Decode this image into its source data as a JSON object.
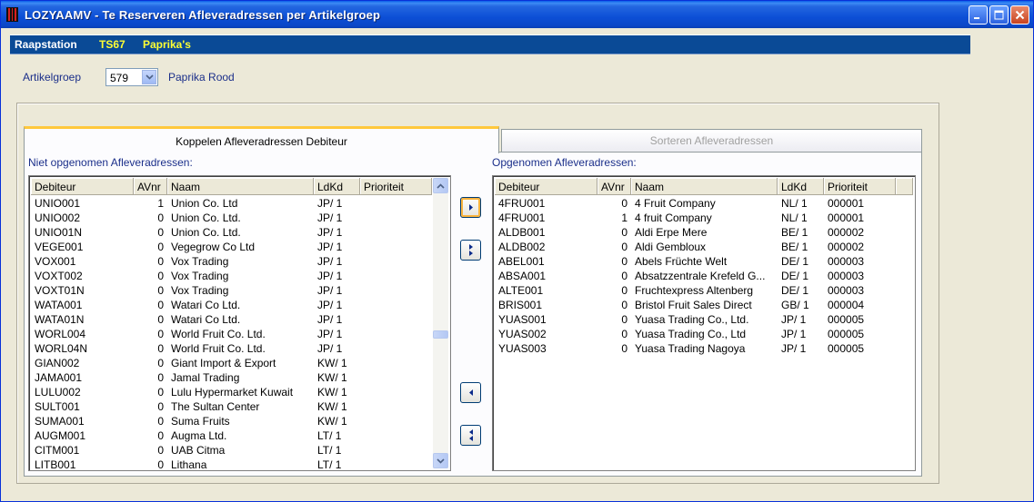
{
  "window": {
    "title": "LOZYAAMV - Te Reserveren Afleveradressen per Artikelgroep",
    "minimize": "_",
    "maximize": "□",
    "close": "✕"
  },
  "station": {
    "label": "Raapstation",
    "code": "TS67",
    "name": "Paprika's"
  },
  "artikelgroep": {
    "label": "Artikelgroep",
    "value": "579",
    "description": "Paprika Rood"
  },
  "tabs": [
    {
      "label": "Koppelen Afleveradressen Debiteur",
      "active": true
    },
    {
      "label": "Sorteren Afleveradressen",
      "active": false
    }
  ],
  "left_list": {
    "label": "Niet opgenomen Afleveradressen:",
    "columns": [
      "Debiteur",
      "AVnr",
      "Naam",
      "LdKd",
      "Prioriteit"
    ],
    "rows": [
      [
        "UNIO001",
        "1",
        "Union Co. Ltd",
        "JP/ 1",
        ""
      ],
      [
        "UNIO002",
        "0",
        "Union Co. Ltd.",
        "JP/ 1",
        ""
      ],
      [
        "UNIO01N",
        "0",
        "Union Co. Ltd.",
        "JP/ 1",
        ""
      ],
      [
        "VEGE001",
        "0",
        "Vegegrow Co Ltd",
        "JP/ 1",
        ""
      ],
      [
        "VOX001",
        "0",
        "Vox Trading",
        "JP/ 1",
        ""
      ],
      [
        "VOXT002",
        "0",
        "Vox Trading",
        "JP/ 1",
        ""
      ],
      [
        "VOXT01N",
        "0",
        "Vox Trading",
        "JP/ 1",
        ""
      ],
      [
        "WATA001",
        "0",
        "Watari Co Ltd.",
        "JP/ 1",
        ""
      ],
      [
        "WATA01N",
        "0",
        "Watari Co Ltd.",
        "JP/ 1",
        ""
      ],
      [
        "WORL004",
        "0",
        "World Fruit Co. Ltd.",
        "JP/ 1",
        ""
      ],
      [
        "WORL04N",
        "0",
        "World Fruit Co. Ltd.",
        "JP/ 1",
        ""
      ],
      [
        "GIAN002",
        "0",
        "Giant Import & Export",
        "KW/ 1",
        ""
      ],
      [
        "JAMA001",
        "0",
        "Jamal Trading",
        "KW/ 1",
        ""
      ],
      [
        "LULU002",
        "0",
        "Lulu Hypermarket Kuwait",
        "KW/ 1",
        ""
      ],
      [
        "SULT001",
        "0",
        "The Sultan Center",
        "KW/ 1",
        ""
      ],
      [
        "SUMA001",
        "0",
        "Suma Fruits",
        "KW/ 1",
        ""
      ],
      [
        "AUGM001",
        "0",
        "Augma Ltd.",
        "LT/ 1",
        ""
      ],
      [
        "CITM001",
        "0",
        "UAB Citma",
        "LT/ 1",
        ""
      ],
      [
        "LITB001",
        "0",
        "Lithana",
        "LT/ 1",
        ""
      ]
    ]
  },
  "right_list": {
    "label": "Opgenomen Afleveradressen:",
    "columns": [
      "Debiteur",
      "AVnr",
      "Naam",
      "LdKd",
      "Prioriteit"
    ],
    "rows": [
      [
        "4FRU001",
        "0",
        "4 Fruit Company",
        "NL/ 1",
        "000001"
      ],
      [
        "4FRU001",
        "1",
        "4 fruit Company",
        "NL/ 1",
        "000001"
      ],
      [
        "ALDB001",
        "0",
        "Aldi Erpe Mere",
        "BE/ 1",
        "000002"
      ],
      [
        "ALDB002",
        "0",
        "Aldi Gembloux",
        "BE/ 1",
        "000002"
      ],
      [
        "ABEL001",
        "0",
        "Abels Früchte Welt",
        "DE/ 1",
        "000003"
      ],
      [
        "ABSA001",
        "0",
        "Absatzzentrale Krefeld G...",
        "DE/ 1",
        "000003"
      ],
      [
        "ALTE001",
        "0",
        "Fruchtexpress Altenberg",
        "DE/ 1",
        "000003"
      ],
      [
        "BRIS001",
        "0",
        "Bristol Fruit Sales Direct",
        "GB/ 1",
        "000004"
      ],
      [
        "YUAS001",
        "0",
        "Yuasa Trading Co., Ltd.",
        "JP/ 1",
        "000005"
      ],
      [
        "YUAS002",
        "0",
        "Yuasa Trading Co., Ltd",
        "JP/ 1",
        "000005"
      ],
      [
        "YUAS003",
        "0",
        "Yuasa Trading Nagoya",
        "JP/ 1",
        "000005"
      ]
    ]
  },
  "icons": {
    "add_one": "triangle-right-icon",
    "add_all": "double-triangle-right-icon",
    "remove_one": "triangle-left-icon",
    "remove_all": "double-triangle-left-icon"
  },
  "colors": {
    "accent_blue": "#0a4a96",
    "station_highlight": "#ffff33",
    "label_blue": "#1b2f8a",
    "tab_active_border": "#ffc83c"
  }
}
